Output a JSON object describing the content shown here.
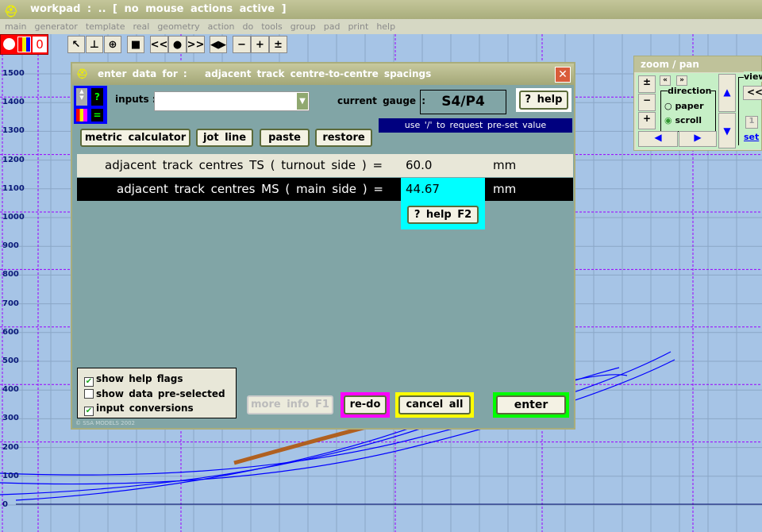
{
  "app": {
    "title": "workpad :  ..  [ no mouse actions active ]"
  },
  "menu": [
    "main",
    "generator",
    "template",
    "real",
    "geometry",
    "action",
    "do",
    "tools",
    "group",
    "pad",
    "print",
    "help"
  ],
  "toolbar": {
    "counter": "0",
    "prev": "<<",
    "dot": "●",
    "next": ">>",
    "minus": "−",
    "plus": "+",
    "fit": "±"
  },
  "axis_labels": [
    "1500",
    "1400",
    "1300",
    "1200",
    "1100",
    "1000",
    "900",
    "800",
    "700",
    "600",
    "500",
    "400",
    "300",
    "200",
    "100",
    "0"
  ],
  "dialog": {
    "title_prefix": "enter  data  for :",
    "title": "adjacent  track  centre-to-centre  spacings",
    "inputs_label": "inputs :",
    "inputs_value": "",
    "gauge_label": "current  gauge :",
    "gauge_value": "S4/P4",
    "help": "? help",
    "hint": "use  '/'  to  request  pre-set  value",
    "buttons": {
      "metric": "metric  calculator",
      "jot": "jot  line",
      "paste": "paste",
      "restore": "restore"
    },
    "rows": [
      {
        "label": "adjacent  track  centres  TS  ( turnout side )  =",
        "value": "60.0",
        "unit": "mm"
      },
      {
        "label": "adjacent  track  centres  MS  ( main side )  =",
        "value": "44.67",
        "unit": "mm"
      }
    ],
    "help_f2": "? help  F2",
    "options": [
      {
        "label": "show  help  flags",
        "checked": true
      },
      {
        "label": "show  data  pre-selected",
        "checked": false
      },
      {
        "label": "input  conversions",
        "checked": true
      }
    ],
    "copyright": "© SSA MODELS 2002",
    "more_info": "more  info  F1",
    "redo": "re-do",
    "cancel": "cancel  all",
    "enter": "enter"
  },
  "zoom_pan": {
    "title": "zoom  /  pan",
    "direction": "direction",
    "paper": "paper",
    "scroll": "scroll",
    "selected": "scroll",
    "view": "view",
    "back": "<<",
    "page": "1",
    "set": "set",
    "left_small": "«",
    "right_small": "»"
  },
  "colors": {
    "canvas": "#a6c4e6",
    "dialog": "#81a5a6",
    "grid_dash": "#9a00ff"
  }
}
